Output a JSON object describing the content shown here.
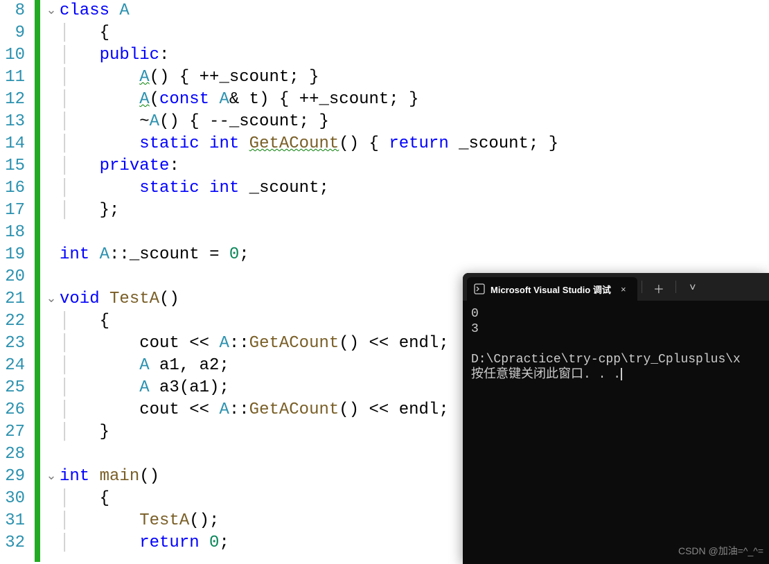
{
  "editor": {
    "line_start": 8,
    "line_end": 32,
    "fold_markers": {
      "8": "v",
      "21": "v",
      "29": "v"
    },
    "lines": [
      [
        [
          "kw",
          "class"
        ],
        [
          "sp",
          " "
        ],
        [
          "type",
          "A"
        ]
      ],
      [
        [
          "punct",
          "{"
        ]
      ],
      [
        [
          "kw",
          "public"
        ],
        [
          "punct",
          ":"
        ]
      ],
      [
        [
          "sp",
          "    "
        ],
        [
          "type squiggle",
          "A"
        ],
        [
          "punct",
          "() { ++_scount; }"
        ]
      ],
      [
        [
          "sp",
          "    "
        ],
        [
          "type squiggle",
          "A"
        ],
        [
          "punct",
          "("
        ],
        [
          "kw",
          "const"
        ],
        [
          "sp",
          " "
        ],
        [
          "type",
          "A"
        ],
        [
          "punct",
          "& "
        ],
        [
          "ident",
          "t"
        ],
        [
          "punct",
          ") { ++_scount; }"
        ]
      ],
      [
        [
          "sp",
          "    "
        ],
        [
          "punct",
          "~"
        ],
        [
          "type",
          "A"
        ],
        [
          "punct",
          "() { --_scount; }"
        ]
      ],
      [
        [
          "sp",
          "    "
        ],
        [
          "kw",
          "static"
        ],
        [
          "sp",
          " "
        ],
        [
          "kw",
          "int"
        ],
        [
          "sp",
          " "
        ],
        [
          "func-u",
          "GetACount"
        ],
        [
          "punct",
          "() { "
        ],
        [
          "kw",
          "return"
        ],
        [
          "sp",
          " "
        ],
        [
          "ident",
          "_scount"
        ],
        [
          "punct",
          "; }"
        ]
      ],
      [
        [
          "kw",
          "private"
        ],
        [
          "punct",
          ":"
        ]
      ],
      [
        [
          "sp",
          "    "
        ],
        [
          "kw",
          "static"
        ],
        [
          "sp",
          " "
        ],
        [
          "kw",
          "int"
        ],
        [
          "sp",
          " "
        ],
        [
          "ident",
          "_scount"
        ],
        [
          "punct",
          ";"
        ]
      ],
      [
        [
          "punct",
          "};"
        ]
      ],
      [],
      [
        [
          "kw",
          "int"
        ],
        [
          "sp",
          " "
        ],
        [
          "type",
          "A"
        ],
        [
          "punct",
          "::"
        ],
        [
          "ident",
          "_scount"
        ],
        [
          "sp",
          " "
        ],
        [
          "punct",
          "= "
        ],
        [
          "num",
          "0"
        ],
        [
          "punct",
          ";"
        ]
      ],
      [],
      [
        [
          "kw",
          "void"
        ],
        [
          "sp",
          " "
        ],
        [
          "func",
          "TestA"
        ],
        [
          "punct",
          "()"
        ]
      ],
      [
        [
          "punct",
          "{"
        ]
      ],
      [
        [
          "sp",
          "    "
        ],
        [
          "ident",
          "cout"
        ],
        [
          "sp",
          " "
        ],
        [
          "punct",
          "<< "
        ],
        [
          "type",
          "A"
        ],
        [
          "punct",
          "::"
        ],
        [
          "func",
          "GetACount"
        ],
        [
          "punct",
          "() << "
        ],
        [
          "ident",
          "endl"
        ],
        [
          "punct",
          ";"
        ]
      ],
      [
        [
          "sp",
          "    "
        ],
        [
          "type",
          "A"
        ],
        [
          "sp",
          " "
        ],
        [
          "ident",
          "a1"
        ],
        [
          "punct",
          ", "
        ],
        [
          "ident",
          "a2"
        ],
        [
          "punct",
          ";"
        ]
      ],
      [
        [
          "sp",
          "    "
        ],
        [
          "type",
          "A"
        ],
        [
          "sp",
          " "
        ],
        [
          "ident",
          "a3"
        ],
        [
          "punct",
          "("
        ],
        [
          "ident",
          "a1"
        ],
        [
          "punct",
          ");"
        ]
      ],
      [
        [
          "sp",
          "    "
        ],
        [
          "ident",
          "cout"
        ],
        [
          "sp",
          " "
        ],
        [
          "punct",
          "<< "
        ],
        [
          "type",
          "A"
        ],
        [
          "punct",
          "::"
        ],
        [
          "func",
          "GetACount"
        ],
        [
          "punct",
          "() << "
        ],
        [
          "ident",
          "endl"
        ],
        [
          "punct",
          ";"
        ]
      ],
      [
        [
          "punct",
          "}"
        ]
      ],
      [],
      [
        [
          "kw",
          "int"
        ],
        [
          "sp",
          " "
        ],
        [
          "func",
          "main"
        ],
        [
          "punct",
          "()"
        ]
      ],
      [
        [
          "punct",
          "{"
        ]
      ],
      [
        [
          "sp",
          "    "
        ],
        [
          "func",
          "TestA"
        ],
        [
          "punct",
          "();"
        ]
      ],
      [
        [
          "sp",
          "    "
        ],
        [
          "kw",
          "return"
        ],
        [
          "sp",
          " "
        ],
        [
          "num",
          "0"
        ],
        [
          "punct",
          ";"
        ]
      ]
    ],
    "guides": {
      "9": 1,
      "10": 1,
      "11": 1,
      "12": 1,
      "13": 1,
      "14": 1,
      "15": 1,
      "16": 1,
      "17": 1,
      "22": 1,
      "23": 1,
      "24": 1,
      "25": 1,
      "26": 1,
      "27": 1,
      "30": 1,
      "31": 1,
      "32": 1
    }
  },
  "terminal": {
    "tab_title": "Microsoft Visual Studio 调试",
    "output_lines": [
      "0",
      "3",
      "",
      "D:\\Cpractice\\try-cpp\\try_Cplusplus\\x",
      "按任意键关闭此窗口. . ."
    ]
  },
  "watermark": "CSDN @加油=^_^="
}
